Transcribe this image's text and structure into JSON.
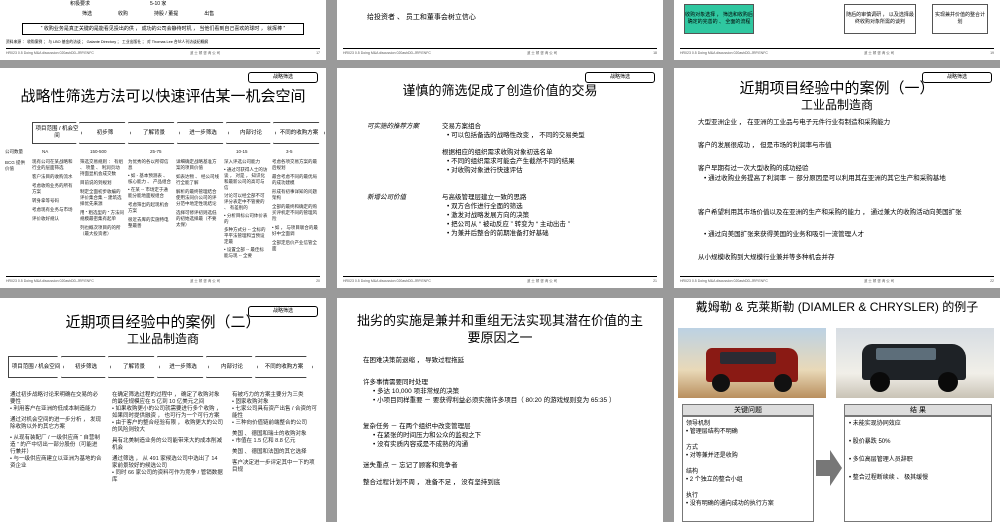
{
  "s1": {
    "rows": [
      "积极要求"
    ],
    "range": "5-10 家",
    "header_cols": [
      "筛选",
      "收购",
      "持股 / 董提",
      "出售"
    ],
    "quote": "“ 收购业务是真正关键的是能看见投出的供 ， 成功的公司会静待时机 ， 当他们看到自己喜欢的球时 ， 就挥棒 ”",
    "source": "资料来源 ： 收购案例 ； 与 LBO 基金的访谈 ； Galante Directory ； 工业出版社 ； 对 Thomas Lee 合伙人刊访谈纪概纲"
  },
  "s2": {
    "text": "给投资者 、 员工和董事会树立信心"
  },
  "s3": {
    "box1": "收购对象选择 ， 筛选和收购后确定的完善的 、 全面的流程",
    "box2": "随后的审慎调研 ， 以及选择最终收购对象所需的谈判",
    "box3": "实现兼并价值的整合计划"
  },
  "s4": {
    "tag": "战略筛选",
    "title": "战略性筛选方法可以快速评估某一机会空间",
    "steps": [
      "项目范围 / 机会空间",
      "初步筛",
      "了解背景",
      "进一步筛选",
      "内部讨论",
      "不同的收购方案"
    ],
    "left_labels": [
      "公司数量",
      "BCG 提供 价值"
    ],
    "counts": [
      "NA",
      "150-500",
      "25-75",
      "10-15",
      "3-5"
    ],
    "col1": [
      "现有公司在某战略和行业的层面筛选",
      "客户法目的收购流水",
      "考虑收购业务的所有方案",
      "转身拿等号码",
      "考虑现有业务与市场",
      "评价收好规认"
    ],
    "col2": [
      "筛选交易规则 ： 有组 、 项量 、 利润页动持面显机会成交数",
      "目前说的到规划",
      "制定全面初步收编的评价集合集 -- 建筑选择优先来源",
      "用 “ 粗选型的 ” 方法同规模最密集有起单",
      "列也概次项目的的所（最大投资者）"
    ],
    "col3": [
      "为优秀的各以所得信息",
      "• 如 - 基本预测表 、 核心能力 、 产品组合",
      "• 在某 -- 市场定于通能分能地面规组合",
      "考虑筛出的起现机会方案",
      "很近去库的实施特电整最善"
    ],
    "col4": [
      "详细确定战略基准方案的项目价值",
      "如表达物 、 经公司线行全能了解",
      "解析的最终管理结合使用法同价公司的评分范中地定性现结论",
      "选择可修评初则选低的初始选择最（不要太保）"
    ],
    "col5": [
      "深入评选公司能力",
      "• 通过可获得人士的访谈 ， 对是 ， 知识化和最新公司的高可与信",
      "讨论可以经全部不可评分表定中不管要的 、 有差别的",
      "• 分析目标公司体价表的",
      "多种方式分 -- 全标的平平法管理和当预设定最",
      "• 设置全部 -- 最佳标能与现 -- 全要"
    ],
    "col6": [
      "考虑各项交易方案的最后规划",
      "最合考虑不同的最优局的成功建模",
      "形成有初事详知的问题架构",
      "全部的最终和确定的购买评机定不同的管理风险",
      "• 如 ， 与项目联合的最好中全面调",
      "全部定后价产业信管全面"
    ]
  },
  "s5": {
    "tag": "战略筛选",
    "title": "谨慎的筛选促成了创造价值的交易",
    "label1": "可实施的推荐方案",
    "item1": "交易方案组合",
    "item1_b": [
      "可以包括备选的战略性改变 ， 不同的交易类型"
    ],
    "item2": "根据相应的组织需求收购对象初选名单",
    "item2_b": [
      "不同的组织需求可能会产生截然不同的结果",
      "对收购对象进行快速评估"
    ],
    "label2": "新增公司价值",
    "item3": "与高级管理层建立一致的思路",
    "item3_b": [
      "双方合作进行全面的筛选",
      "激发对战略发展方向的决策",
      "把公司从 “ 被动反应 ” 转变为 “ 主动出击 ”",
      "为兼并后整合的前期准备打好基础"
    ]
  },
  "s6": {
    "tag": "战略筛选",
    "title": "近期项目经验中的案例（一）",
    "subtitle": "工业品制造商",
    "p1": "大型亚洲企业 ， 在亚洲的工业品与电子元件行业有制造和采购能力",
    "p2": "客户的发展很成功 ， 但是市场的利润率与市值",
    "p3": "客户早期有过一次大型收购的成功经验",
    "p3_b": "通过收购业务提高了利润率 － 部分原因是可以利用其在亚洲的其它生产和采购基地",
    "p4": "客户希望利用其市场价值以及在亚洲的生产和采购的能力 ， 通过兼大的收购活动向美国扩张",
    "p4_b": "通过向美国扩张来获得美国的业务和吸引一流管理人才",
    "p5": "从小规模收购到大规模行业兼并等多种机会并存"
  },
  "s7": {
    "tag": "战略筛选",
    "title": "近期项目经验中的案例（二）",
    "subtitle": "工业品制造商",
    "steps": [
      "项目范围 / 机会空间",
      "初步筛选",
      "了解背景",
      "进一步筛选",
      "内部讨论",
      "不同的收购方案"
    ],
    "col1": [
      "通过初步战略讨论来明确在交易的必要性",
      "• 利用客户在亚洲的低成本制造能力",
      "通过对机会空间的进一步分析 ， 发现除收购以外的其它方案",
      "• 从现有装配厂 / 一级供应商 “ 自营制造 ” 的产中切出一部分股份（可能进行兼并）",
      "• 与一级供应商建立以亚洲为基地的合资企业"
    ],
    "col2": [
      "在确定筛选过程的过程中 ， 确定了收购对象的最佳规模应在 5 亿到 10 亿美元之间",
      "• 如果收购更小的公司就需要进行多个收购 ， 如果同时提供融资 ， 也可行为一个可行方案",
      "• 由于客户的整合经验有限 ， 收购更大的公司的风险则较大",
      "具有北美制造业务的公司能带来大的成本削减机会",
      "通过筛选 ， 从 491 家候选公司中选出了 14 家前景较好的候选公司",
      "• 同时 66 家公司的资料可作为竞争 / 管销数据库"
    ],
    "col3": [
      "有被巧力的方案主要分为三类",
      "• 固家收购对象",
      "• 七家公司具有资产出售 / 合资的可能性",
      "• 三种向价值链前端整合的公司",
      "美国 、 德国和瑞士的收购对象",
      "• 市值在 1.5 亿和 8.8 亿元",
      "美国 、 德国和法国的其它选择",
      "客户决定进一步评定其中一下的项目规"
    ]
  },
  "s8": {
    "title": "拙劣的实施是兼并和重组无法实现其潜在价值的主要原因之一",
    "p1": "在困难决策前退缩 ， 导致过程拖延",
    "p2": "许多事情需要同时处理",
    "p2_b": [
      "多达 10,000 项非常规的决策",
      "小项目同样重要 － 要获得利益必须实施许多项目（ 80:20 的游戏规则变为 65:35 ）"
    ],
    "p3": "复杂任务 － 在两个组织中改变管理层",
    "p3_b": [
      "在紧张的时间压力和公众的监视之下",
      "没有实质内容或是不成熟的沟通"
    ],
    "p4": "迷失重点 － 忘记了顾客和竞争者",
    "p5": "整合过程计划不周 ， 准备不足 ， 没有坚持到底"
  },
  "s9": {
    "title": "戴姆勒 & 克莱斯勒 (DIAMLER & CHRYSLER) 的例子",
    "left_head": "关键问题",
    "right_head": "结 果",
    "left": [
      {
        "h": "领导机制",
        "b": "管理层结构不明确"
      },
      {
        "h": "方式",
        "b": "对等兼并还是收购"
      },
      {
        "h": "结构",
        "b": "2 个独立的整合小组"
      },
      {
        "h": "执行",
        "b": "没有明确的通向成功的执行方案"
      }
    ],
    "right": [
      "未能实现协同效应",
      "股价暴跌 50%",
      "多位高层管理人员辞职",
      "整合过程断续续 、 极其缓慢"
    ]
  },
  "footer": {
    "left": "HR023 0.5 Doing M&A discussion 020ashDD-JRP.ENFC",
    "center": "波 士 顿 咨 询 公 司",
    "pages": [
      "17",
      "18",
      "19",
      "20",
      "21",
      "22",
      "23",
      "24",
      "25"
    ]
  }
}
